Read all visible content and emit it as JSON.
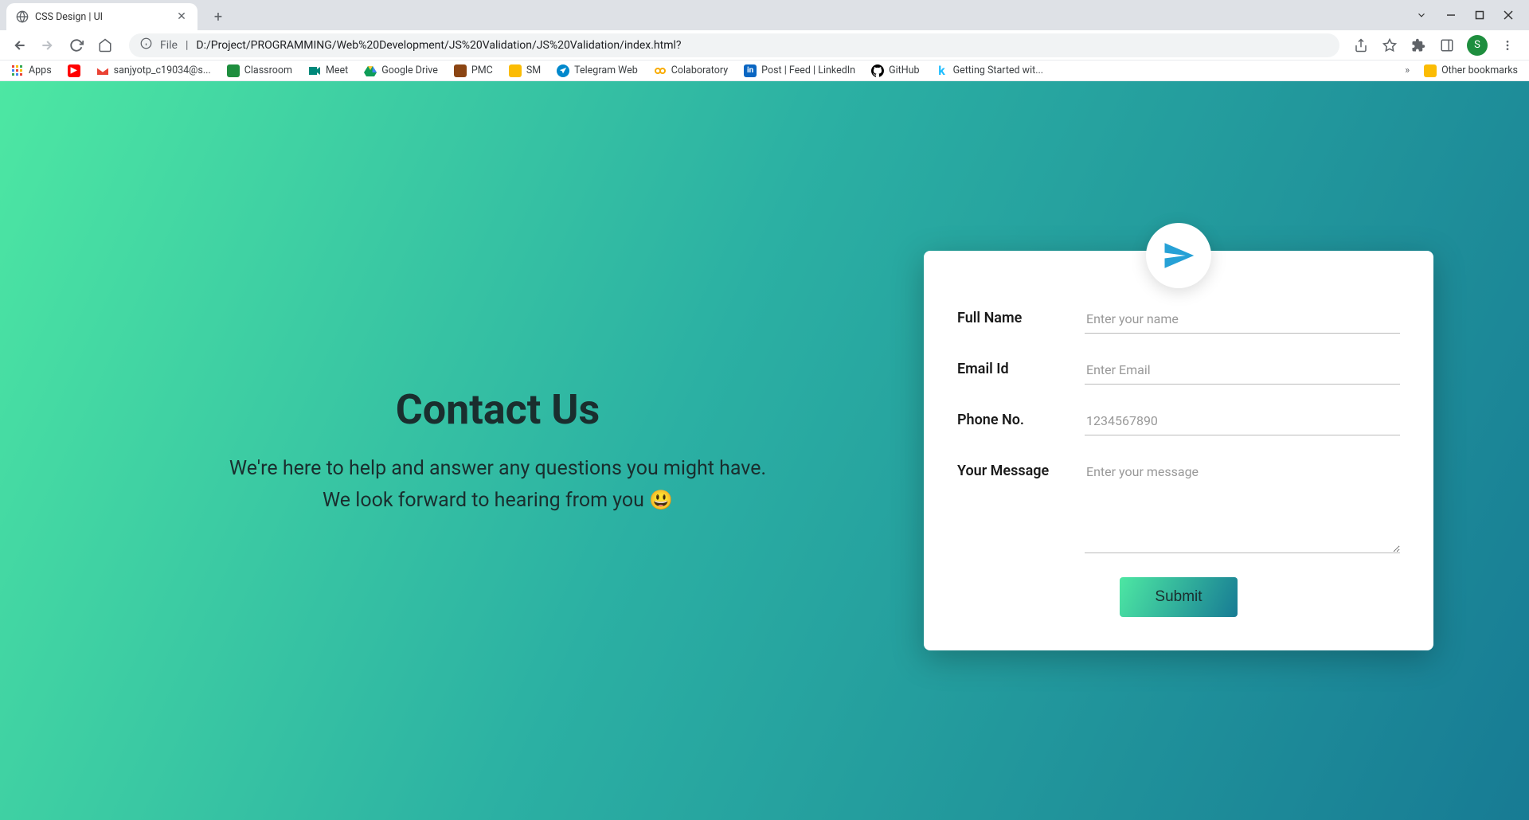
{
  "browser": {
    "tab": {
      "title": "CSS Design | UI"
    },
    "address": {
      "file_label": "File",
      "url": "D:/Project/PROGRAMMING/Web%20Development/JS%20Validation/JS%20Validation/index.html?"
    },
    "avatar_initial": "S",
    "bookmarks": [
      {
        "label": "Apps"
      },
      {
        "label": ""
      },
      {
        "label": "sanjyotp_c19034@s..."
      },
      {
        "label": "Classroom"
      },
      {
        "label": "Meet"
      },
      {
        "label": "Google Drive"
      },
      {
        "label": "PMC"
      },
      {
        "label": "SM"
      },
      {
        "label": "Telegram Web"
      },
      {
        "label": "Colaboratory"
      },
      {
        "label": "Post | Feed | LinkedIn"
      },
      {
        "label": "GitHub"
      },
      {
        "label": "Getting Started wit..."
      }
    ],
    "other_bookmarks": "Other bookmarks"
  },
  "page": {
    "heading": "Contact Us",
    "line1": "We're here to help and answer any questions you might have.",
    "line2_prefix": "We look forward to hearing from you ",
    "emoji": "😃"
  },
  "form": {
    "fields": {
      "name": {
        "label": "Full Name",
        "placeholder": "Enter your name",
        "value": ""
      },
      "email": {
        "label": "Email Id",
        "placeholder": "Enter Email",
        "value": ""
      },
      "phone": {
        "label": "Phone No.",
        "placeholder": "1234567890",
        "value": ""
      },
      "message": {
        "label": "Your Message",
        "placeholder": "Enter your message",
        "value": ""
      }
    },
    "submit_label": "Submit"
  }
}
